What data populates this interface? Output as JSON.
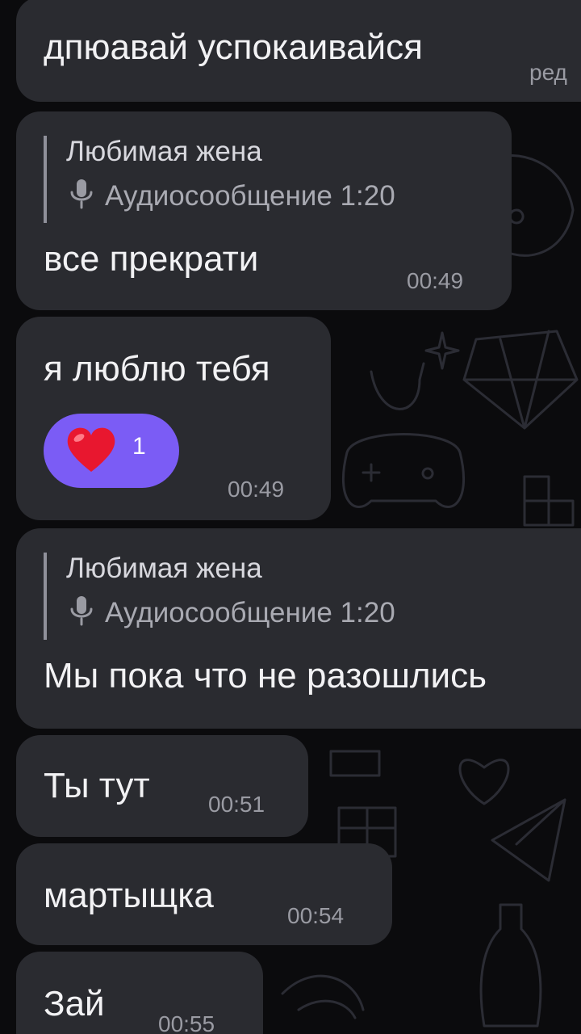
{
  "messages": [
    {
      "text": "дпюавай успокаивайся",
      "meta": "ред"
    },
    {
      "reply": {
        "author": "Любимая жена",
        "preview": "Аудиосообщение 1:20"
      },
      "text": "все прекрати",
      "time": "00:49"
    },
    {
      "text": "я люблю тебя",
      "reaction": {
        "emoji": "heart-icon",
        "count": "1"
      },
      "time": "00:49"
    },
    {
      "reply": {
        "author": "Любимая жена",
        "preview": "Аудиосообщение 1:20"
      },
      "text": "Мы пока что не разошлись"
    },
    {
      "text": "Ты тут",
      "time": "00:51"
    },
    {
      "text": "мартыщка",
      "time": "00:54"
    },
    {
      "text": "Зай",
      "time": "00:55"
    }
  ],
  "colors": {
    "background": "#0b0b0d",
    "bubble": "#2a2b30",
    "reaction": "#7b5cf5",
    "heart": "#e8172f"
  }
}
